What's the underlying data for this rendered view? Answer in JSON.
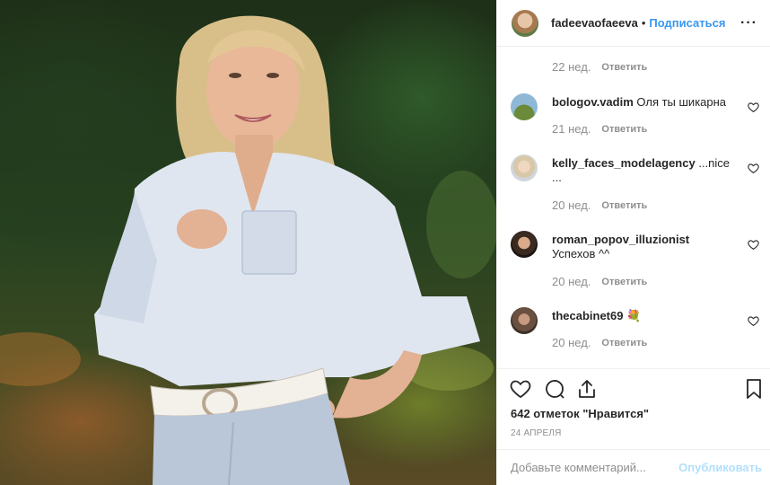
{
  "header": {
    "username": "fadeevaofaeeva",
    "separator": "•",
    "follow_label": "Подписаться",
    "more_label": "···"
  },
  "comments": [
    {
      "username": "",
      "text": "",
      "time": "22 нед.",
      "reply_label": "Ответить"
    },
    {
      "username": "bologov.vadim",
      "text": "Оля ты шикарна",
      "time": "21 нед.",
      "reply_label": "Ответить"
    },
    {
      "username": "kelly_faces_modelagency",
      "text": "...nice ...",
      "time": "20 нед.",
      "reply_label": "Ответить"
    },
    {
      "username": "roman_popov_illuzionist",
      "text": "Успехов ^^",
      "time": "20 нед.",
      "reply_label": "Ответить"
    },
    {
      "username": "thecabinet69",
      "text": "💐",
      "time": "20 нед.",
      "reply_label": "Ответить"
    }
  ],
  "actions": {
    "likes_text": "642 отметок \"Нравится\"",
    "date": "24 АПРЕЛЯ"
  },
  "add_comment": {
    "placeholder": "Добавьте комментарий...",
    "publish_label": "Опубликовать"
  },
  "colors": {
    "accent": "#3897f0",
    "publish_disabled": "#b2dffc",
    "meta_gray": "#8e8e8e"
  }
}
